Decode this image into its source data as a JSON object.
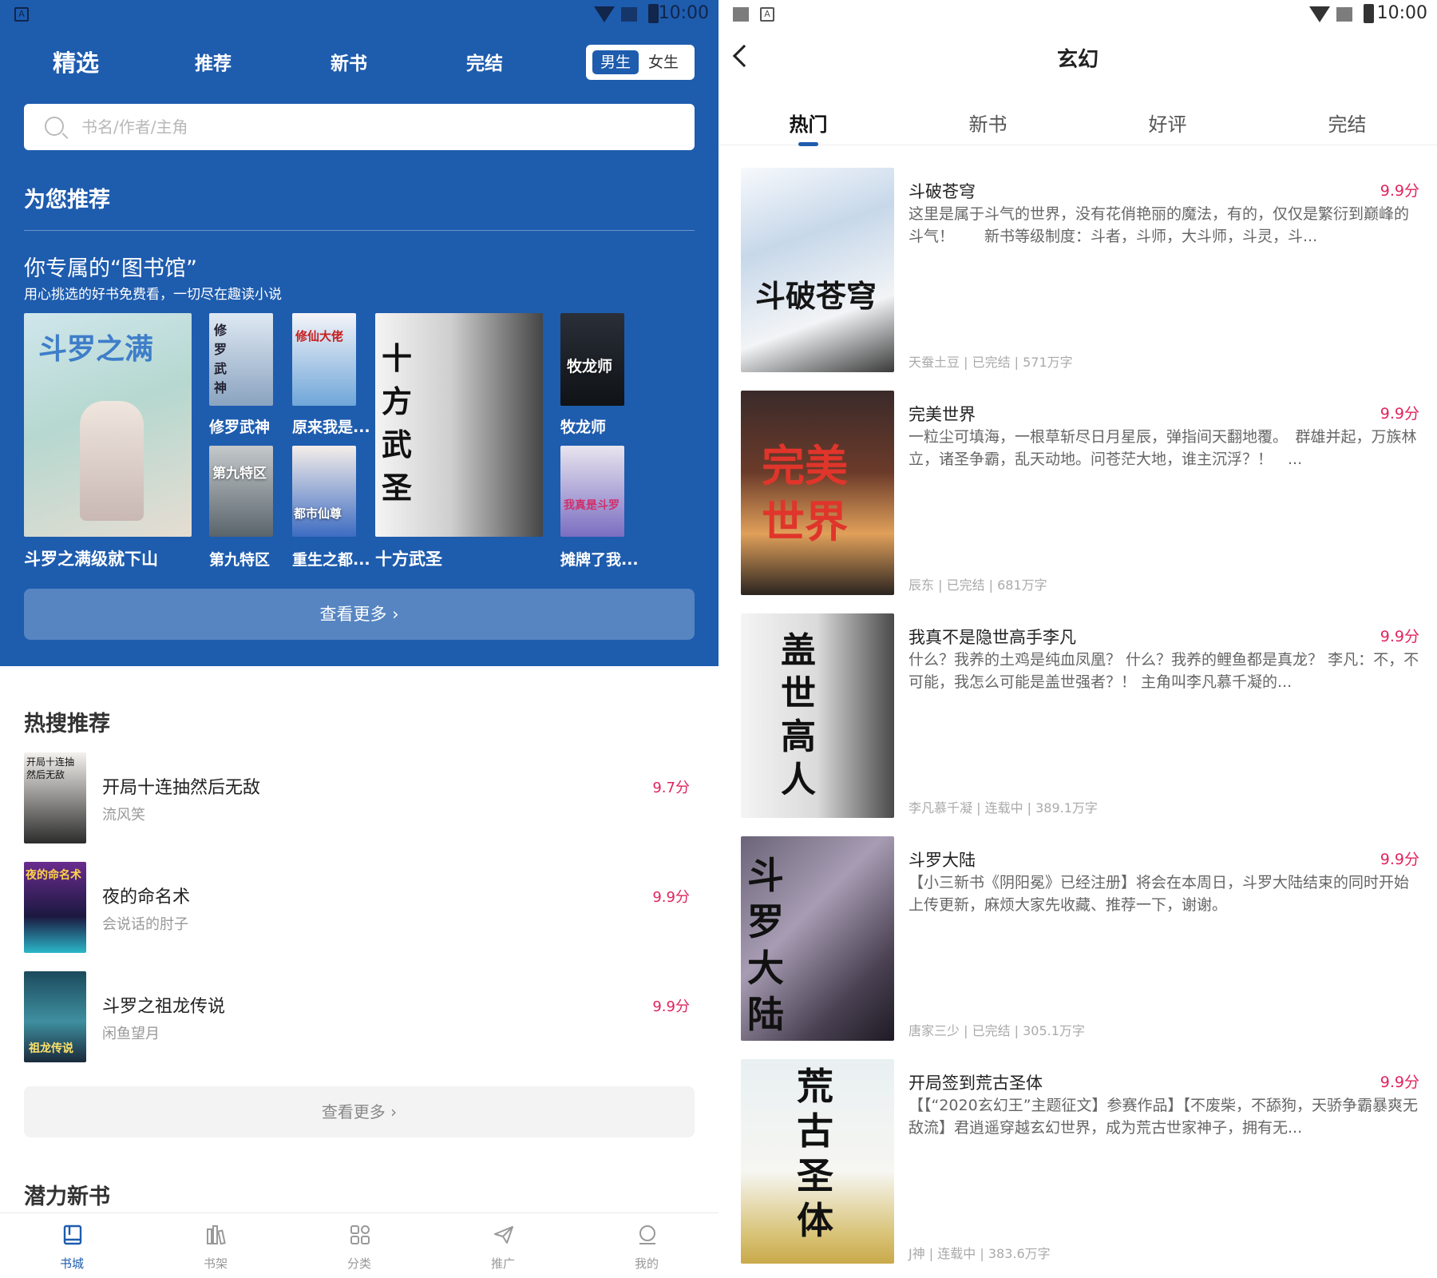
{
  "status_bar": {
    "time": "10:00"
  },
  "left": {
    "nav": {
      "tabs": [
        "精选",
        "推荐",
        "新书",
        "完结"
      ],
      "gender": {
        "male": "男生",
        "female": "女生"
      }
    },
    "search": {
      "placeholder": "书名/作者/主角"
    },
    "recommend": {
      "title": "为您推荐",
      "library_title": "你专属的“图书馆”",
      "library_sub": "用心挑选的好书免费看，一切尽在趣读小说",
      "books": [
        {
          "title": "斗罗之满级就下山",
          "cover_text": "斗罗之满"
        },
        {
          "title": "修罗武神",
          "cover_text": "修罗武神"
        },
        {
          "title": "原来我是...",
          "cover_text": "修仙大佬"
        },
        {
          "title": "十方武圣",
          "cover_text": "十方武圣"
        },
        {
          "title": "牧龙师",
          "cover_text": "牧龙师"
        },
        {
          "title": "第九特区",
          "cover_text": "第九特区"
        },
        {
          "title": "重生之都...",
          "cover_text": "都市仙尊"
        },
        {
          "title": "摊牌了我...",
          "cover_text": "我真是斗罗"
        }
      ],
      "more": "查看更多 ›"
    },
    "hot": {
      "title": "热搜推荐",
      "items": [
        {
          "name": "开局十连抽然后无敌",
          "author": "流风笑",
          "score": "9.7分",
          "cover_text": "开局十连抽 然后无敌"
        },
        {
          "name": "夜的命名术",
          "author": "会说话的肘子",
          "score": "9.9分",
          "cover_text": "夜的命名术"
        },
        {
          "name": "斗罗之祖龙传说",
          "author": "闲鱼望月",
          "score": "9.9分",
          "cover_text": "祖龙传说"
        }
      ],
      "more": "查看更多 ›"
    },
    "new_books": {
      "title": "潜力新书"
    },
    "tabbar": [
      {
        "label": "书城",
        "icon": "book-icon"
      },
      {
        "label": "书架",
        "icon": "bookshelf-icon"
      },
      {
        "label": "分类",
        "icon": "grid-icon"
      },
      {
        "label": "推广",
        "icon": "paper-plane-icon"
      },
      {
        "label": "我的",
        "icon": "user-icon"
      }
    ]
  },
  "right": {
    "title": "玄幻",
    "tabs": [
      "热门",
      "新书",
      "好评",
      "完结"
    ],
    "items": [
      {
        "name": "斗破苍穹",
        "score": "9.9分",
        "desc": "这里是属于斗气的世界，没有花俏艳丽的魔法，有的，仅仅是繁衍到巅峰的斗气！　　新书等级制度：斗者，斗师，大斗师，斗灵，斗...",
        "meta": "天蚕土豆 | 已完结 | 571万字",
        "cover_text": "斗破苍穹"
      },
      {
        "name": "完美世界",
        "score": "9.9分",
        "desc": "一粒尘可填海，一根草斩尽日月星辰，弹指间天翻地覆。　群雄并起，万族林立，诸圣争霸，乱天动地。问苍茫大地，谁主沉浮？！　...",
        "meta": "辰东 | 已完结 | 681万字",
        "cover_text": "完美世界"
      },
      {
        "name": "我真不是隐世高手李凡",
        "score": "9.9分",
        "desc": "什么？我养的土鸡是纯血凤凰？ 什么？我养的鲤鱼都是真龙？ 李凡：不，不可能，我怎么可能是盖世强者？！ 主角叫李凡慕千凝的...",
        "meta": "李凡慕千凝 | 连载中 | 389.1万字",
        "cover_text": "盖世高人"
      },
      {
        "name": "斗罗大陆",
        "score": "9.9分",
        "desc": "【小三新书《阴阳冕》已经注册】将会在本周日，斗罗大陆结束的同时开始上传更新，麻烦大家先收藏、推荐一下，谢谢。",
        "meta": "唐家三少 | 已完结 | 305.1万字",
        "cover_text": "斗罗大陆"
      },
      {
        "name": "开局签到荒古圣体",
        "score": "9.9分",
        "desc": "【【“2020玄幻王”主题征文】参赛作品】【不废柴，不舔狗，天骄争霸暴爽无敌流】君逍遥穿越玄幻世界，成为荒古世家神子，拥有无...",
        "meta": "J神 | 连载中 | 383.6万字",
        "cover_text": "荒古圣体"
      }
    ]
  },
  "colors": {
    "primary": "#1e5cae",
    "score": "#e0245e"
  }
}
